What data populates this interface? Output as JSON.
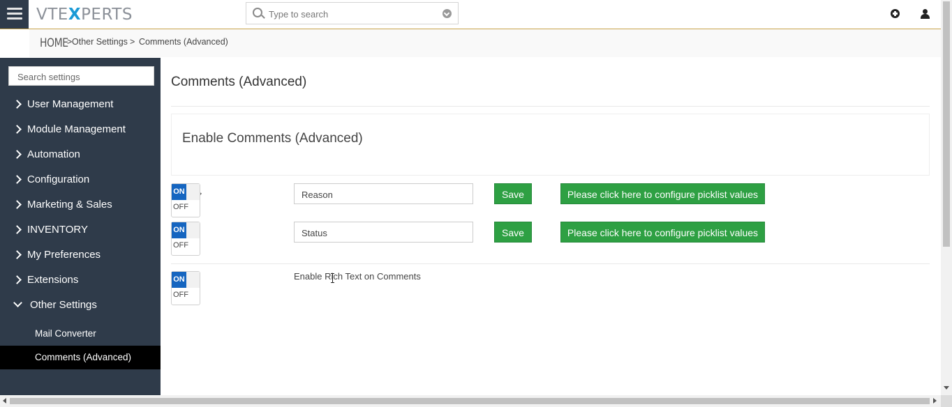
{
  "header": {
    "logo_prefix": "VTE",
    "logo_x": "X",
    "logo_suffix": "PERTS",
    "search_placeholder": "Type to search",
    "icons": [
      "menu-icon",
      "search-icon",
      "dropdown-icon",
      "add-icon",
      "user-icon"
    ]
  },
  "breadcrumb": {
    "home": "HOME",
    "sep1": ">",
    "level1": "Other Settings",
    "sep2": ">",
    "current": "Comments (Advanced)"
  },
  "sidebar": {
    "search_placeholder": "Search settings",
    "items": [
      {
        "label": "User Management"
      },
      {
        "label": "Module Management"
      },
      {
        "label": "Automation"
      },
      {
        "label": "Configuration"
      },
      {
        "label": "Marketing & Sales"
      },
      {
        "label": "INVENTORY"
      },
      {
        "label": "My Preferences"
      },
      {
        "label": "Extensions"
      },
      {
        "label": "Other Settings"
      }
    ],
    "sub_items": [
      {
        "label": "Mail Converter"
      },
      {
        "label": "Comments (Advanced)"
      }
    ]
  },
  "main": {
    "title": "Comments (Advanced)",
    "panel_title": "Enable Comments (Advanced)",
    "rows": [
      {
        "toggle_on": "ON",
        "toggle_off": "OFF",
        "field_value": "Reason",
        "save_label": "Save",
        "picklist_label": "Please click here to configure picklist values"
      },
      {
        "toggle_on": "ON",
        "toggle_off": "OFF",
        "field_value": "Status",
        "save_label": "Save",
        "picklist_label": "Please click here to configure picklist values"
      }
    ],
    "rich_text": {
      "toggle_on": "ON",
      "toggle_off": "OFF",
      "label": "Enable Rich Text on Comments"
    }
  },
  "colors": {
    "sidebar_bg": "#2f3b4a",
    "accent_border": "#c8a24a",
    "toggle_on": "#1565c0",
    "button_green": "#2ea043",
    "logo_x": "#1a9ad6"
  }
}
